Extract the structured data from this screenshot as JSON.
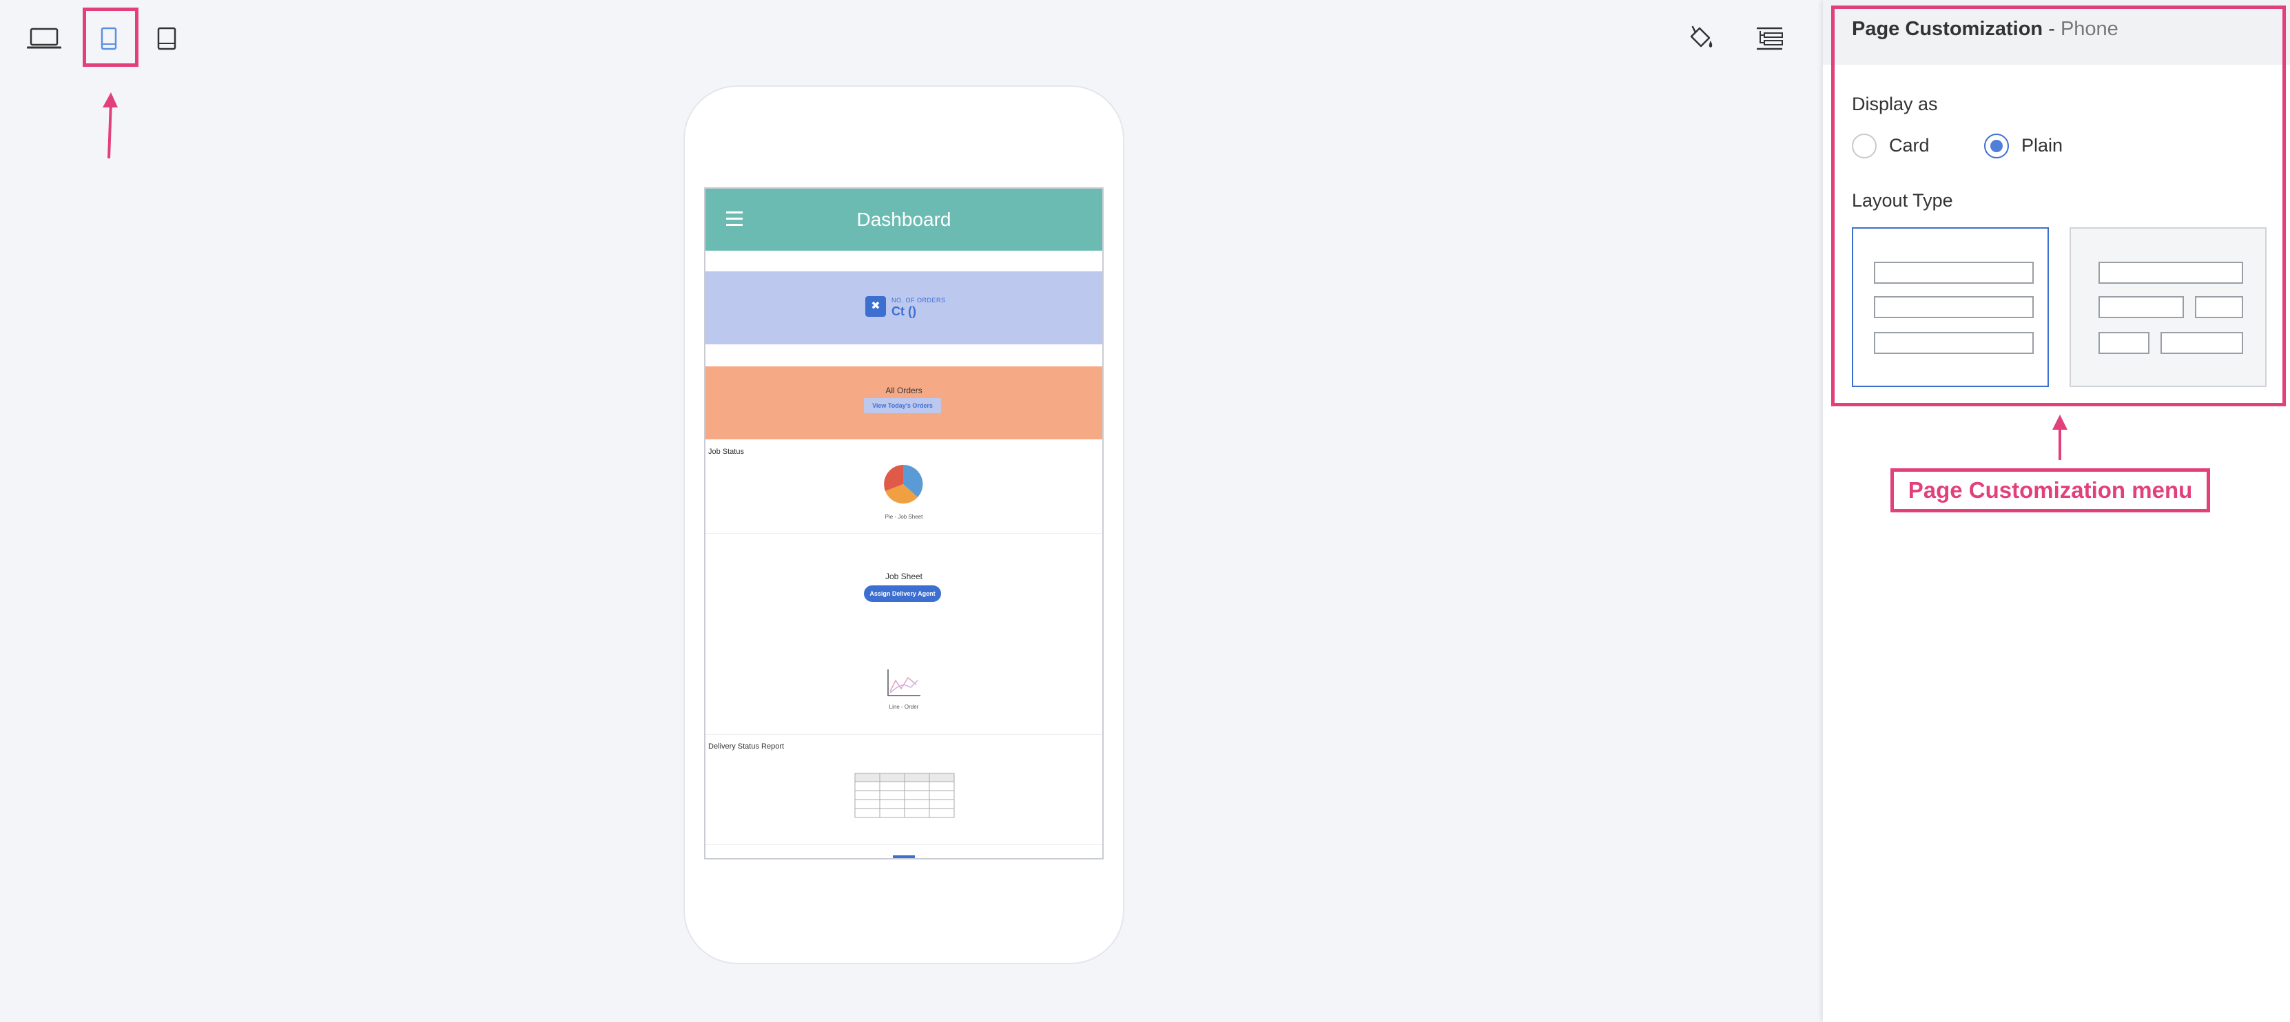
{
  "toolbar": {
    "devices": [
      {
        "name": "laptop-icon",
        "label": "Desktop"
      },
      {
        "name": "phone-icon",
        "label": "Phone",
        "selected": true
      },
      {
        "name": "tablet-icon",
        "label": "Tablet"
      }
    ],
    "tools": [
      {
        "name": "paint-bucket-icon"
      },
      {
        "name": "layout-tree-icon"
      }
    ]
  },
  "phone": {
    "appbar": {
      "title": "Dashboard",
      "color": "#6bbbb3"
    },
    "kpi": {
      "label": "NO. OF ORDERS",
      "value": "Ct ()",
      "color": "#bdc8ef"
    },
    "orders": {
      "title": "All Orders",
      "button": "View Today's Orders",
      "color": "#f5aa85"
    },
    "job_status": {
      "title": "Job Status",
      "caption": "Pie - Job Sheet"
    },
    "job_sheet": {
      "title": "Job Sheet",
      "button": "Assign Delivery Agent"
    },
    "line_chart": {
      "caption": "Line - Order"
    },
    "delivery": {
      "title": "Delivery Status Report"
    }
  },
  "panel": {
    "title": "Page Customization",
    "separator": " - ",
    "mode": "Phone",
    "display_as_label": "Display as",
    "display_options": [
      {
        "label": "Card",
        "selected": false
      },
      {
        "label": "Plain",
        "selected": true
      }
    ],
    "layout_type_label": "Layout Type",
    "layout_options": [
      {
        "name": "single-column-layout",
        "selected": true
      },
      {
        "name": "mixed-column-layout",
        "selected": false
      }
    ]
  },
  "annotation": {
    "label": "Page Customization menu",
    "color": "#e2407a"
  }
}
